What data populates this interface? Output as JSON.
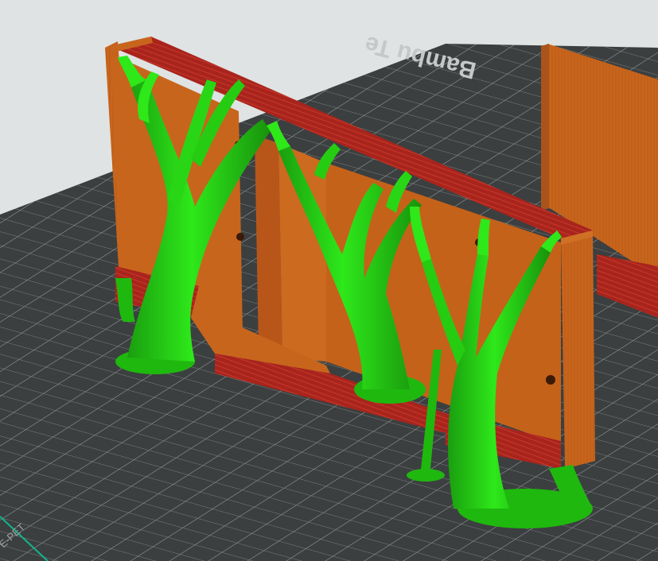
{
  "viewport": {
    "plate_label": "Bambu Te",
    "plate_edge_label": "E-PET"
  },
  "colors": {
    "background": "#dfe3e3",
    "plate": "#3c3f40",
    "grid": "#8e9394",
    "model_orange": "#c8651c",
    "model_red": "#a8241c",
    "support_green": "#25d613",
    "plate_edge_line": "#14b48c"
  },
  "icons": {
    "model": "3d-part-model",
    "supports": "tree-support",
    "plate": "build-plate"
  }
}
